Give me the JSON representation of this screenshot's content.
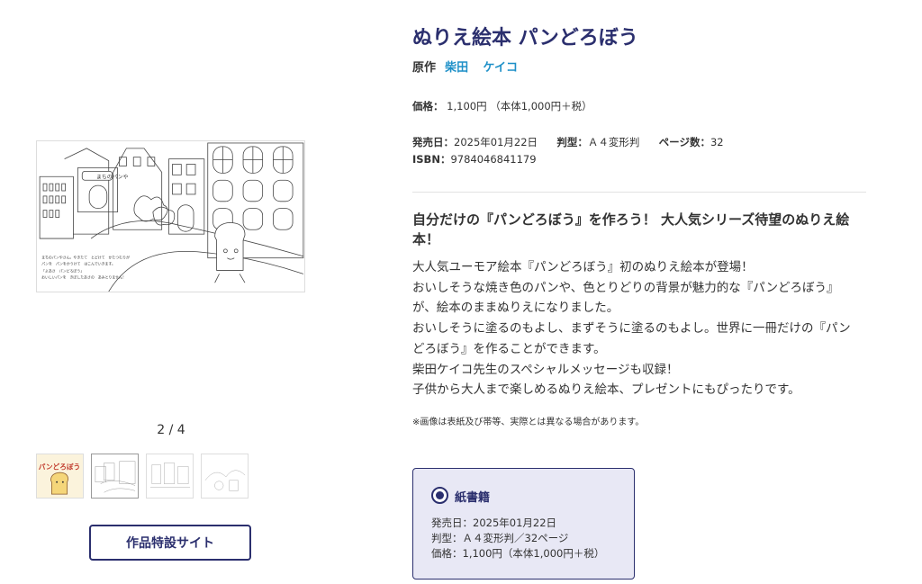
{
  "gallery": {
    "counter": "2 / 4",
    "main_image_sign": "まちのパンや",
    "main_image_caption": [
      "まちのパンやさん。やきたて　とどけて　かたつむりが",
      "パンを　パンをかうけて　はこんでいきます。",
      "「よあさ　パンどろぼう」",
      "おいしいパンを　きぼしたあさの　あみとりません！"
    ],
    "thumb_cover_text": "パンどろぼう",
    "site_button_label": "作品特設サイト"
  },
  "book": {
    "title": "ぬりえ絵本 パンどろぼう",
    "author_role": "原作",
    "author_names": [
      "柴田",
      "ケイコ"
    ],
    "price_label": "価格：",
    "price_value": "1,100円 （本体1,000円＋税）",
    "release_label": "発売日：",
    "release_value": "2025年01月22日",
    "format_label": "判型：",
    "format_value": "Ａ４変形判",
    "pages_label": "ページ数：",
    "pages_value": "32",
    "isbn_label": "ISBN：",
    "isbn_value": "9784046841179"
  },
  "catch_copy": "自分だけの『パンどろぼう』を作ろう！ 大人気シリーズ待望のぬりえ絵本！",
  "description": [
    "大人気ユーモア絵本『パンどろぼう』初のぬりえ絵本が登場！",
    "おいしそうな焼き色のパンや、色とりどりの背景が魅力的な『パンどろぼう』",
    "が、絵本のままぬりえになりました。",
    "おいしそうに塗るのもよし、まずそうに塗るのもよし。世界に一冊だけの『パン",
    "どろぼう』を作ることができます。",
    "柴田ケイコ先生のスペシャルメッセージも収録！",
    "子供から大人まで楽しめるぬりえ絵本、プレゼントにもぴったりです。"
  ],
  "note": "※画像は表紙及び帯等、実際とは異なる場合があります。",
  "format_card": {
    "name": "紙書籍",
    "release": "発売日：2025年01月22日",
    "format": "判型：Ａ４変形判／32ページ",
    "price": "価格：1,100円（本体1,000円＋税）"
  },
  "colors": {
    "brand_navy": "#2b2f6e",
    "link_blue": "#1e90c8",
    "card_bg": "#e8e8f5",
    "cover_yellow": "#f5d67a"
  }
}
